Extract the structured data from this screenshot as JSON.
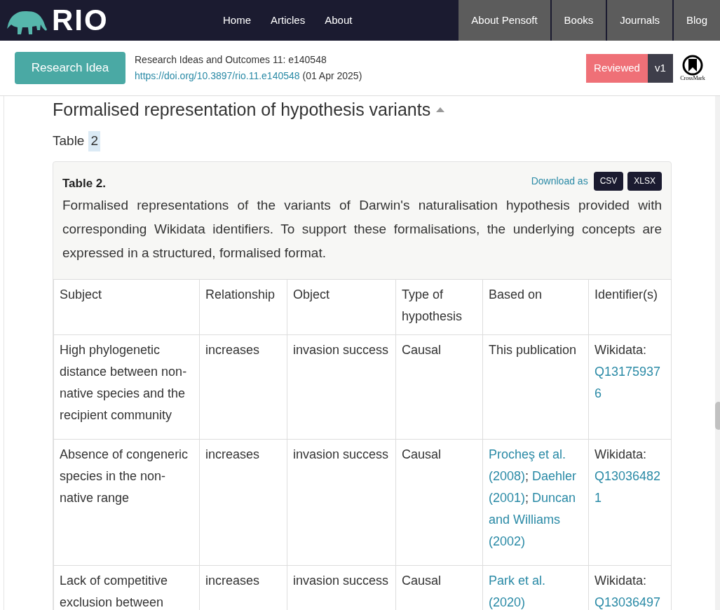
{
  "header": {
    "logo": "RIO",
    "nav": [
      "Home",
      "Articles",
      "About"
    ],
    "external_nav": [
      "About Pensoft",
      "Books",
      "Journals",
      "Blog"
    ]
  },
  "article_bar": {
    "type_button": "Research Idea",
    "journal": "Research Ideas and Outcomes 11: e140548",
    "doi": "https://doi.org/10.3897/rio.11.e140548",
    "date": "(01 Apr 2025)",
    "status": "Reviewed",
    "version": "v1",
    "crossmark": "CrossMark"
  },
  "section": {
    "title": "Formalised representation of hypothesis variants",
    "expanded": true,
    "table_ref": {
      "label": "Table",
      "number": "2"
    }
  },
  "table": {
    "label": "Table 2.",
    "download_label": "Download as",
    "formats": [
      "CSV",
      "XLSX"
    ],
    "caption": "Formalised representations of the variants of Darwin's naturalisation hypothesis provided with corresponding Wikidata identifiers. To support these formalisations, the underlying concepts are expressed in a structured, formalised format.",
    "columns": [
      "Subject",
      "Relationship",
      "Object",
      "Type of hypothesis",
      "Based on",
      "Identifier(s)"
    ],
    "rows": [
      [
        [
          {
            "kind": "text",
            "text": "High phylogenetic distance between non-native species and the recipient community"
          }
        ],
        [
          {
            "kind": "text",
            "text": "increases"
          }
        ],
        [
          {
            "kind": "text",
            "text": "invasion success"
          }
        ],
        [
          {
            "kind": "text",
            "text": "Causal"
          }
        ],
        [
          {
            "kind": "text",
            "text": "This publication"
          }
        ],
        [
          {
            "kind": "text",
            "text": "Wikidata:"
          },
          {
            "kind": "id",
            "text": "Q131759376"
          }
        ]
      ],
      [
        [
          {
            "kind": "text",
            "text": "Absence of congeneric species in the non-native range"
          }
        ],
        [
          {
            "kind": "text",
            "text": "increases"
          }
        ],
        [
          {
            "kind": "text",
            "text": "invasion success"
          }
        ],
        [
          {
            "kind": "text",
            "text": "Causal"
          }
        ],
        [
          {
            "kind": "link",
            "text": "Procheş et al. (2008)"
          },
          {
            "kind": "text",
            "text": ";"
          },
          {
            "kind": "link",
            "text": "Daehler (2001)"
          },
          {
            "kind": "text",
            "text": ";"
          },
          {
            "kind": "link",
            "text": "Duncan and Williams (2002)"
          }
        ],
        [
          {
            "kind": "text",
            "text": "Wikidata:"
          },
          {
            "kind": "id",
            "text": "Q130364821"
          }
        ]
      ],
      [
        [
          {
            "kind": "text",
            "text": "Lack of competitive exclusion between"
          }
        ],
        [
          {
            "kind": "text",
            "text": "increases"
          }
        ],
        [
          {
            "kind": "text",
            "text": "invasion success"
          }
        ],
        [
          {
            "kind": "text",
            "text": "Causal"
          }
        ],
        [
          {
            "kind": "link",
            "text": "Park et al. (2020)"
          }
        ],
        [
          {
            "kind": "text",
            "text": "Wikidata:"
          },
          {
            "kind": "id",
            "text": "Q13036497"
          }
        ]
      ]
    ]
  }
}
